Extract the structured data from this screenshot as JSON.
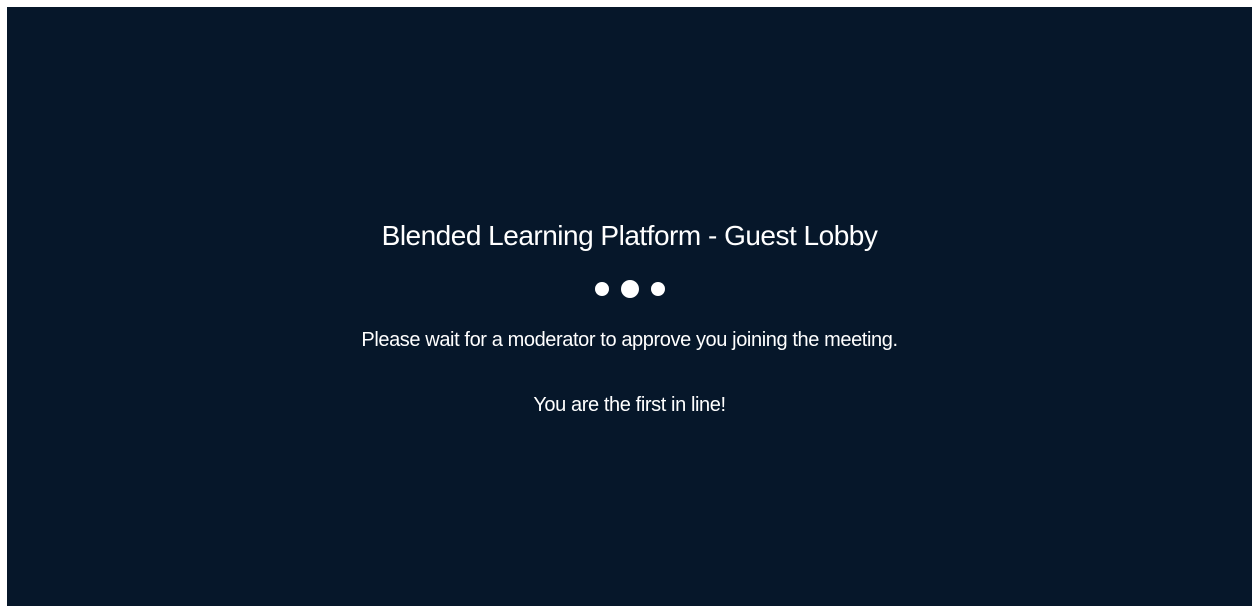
{
  "lobby": {
    "title": "Blended Learning Platform - Guest Lobby",
    "message": "Please wait for a moderator to approve you joining the meeting.",
    "position_text": "You are the first in line!"
  },
  "colors": {
    "background": "#06172a",
    "text": "#ffffff"
  },
  "icons": {
    "loading": "loading-dots-icon"
  }
}
